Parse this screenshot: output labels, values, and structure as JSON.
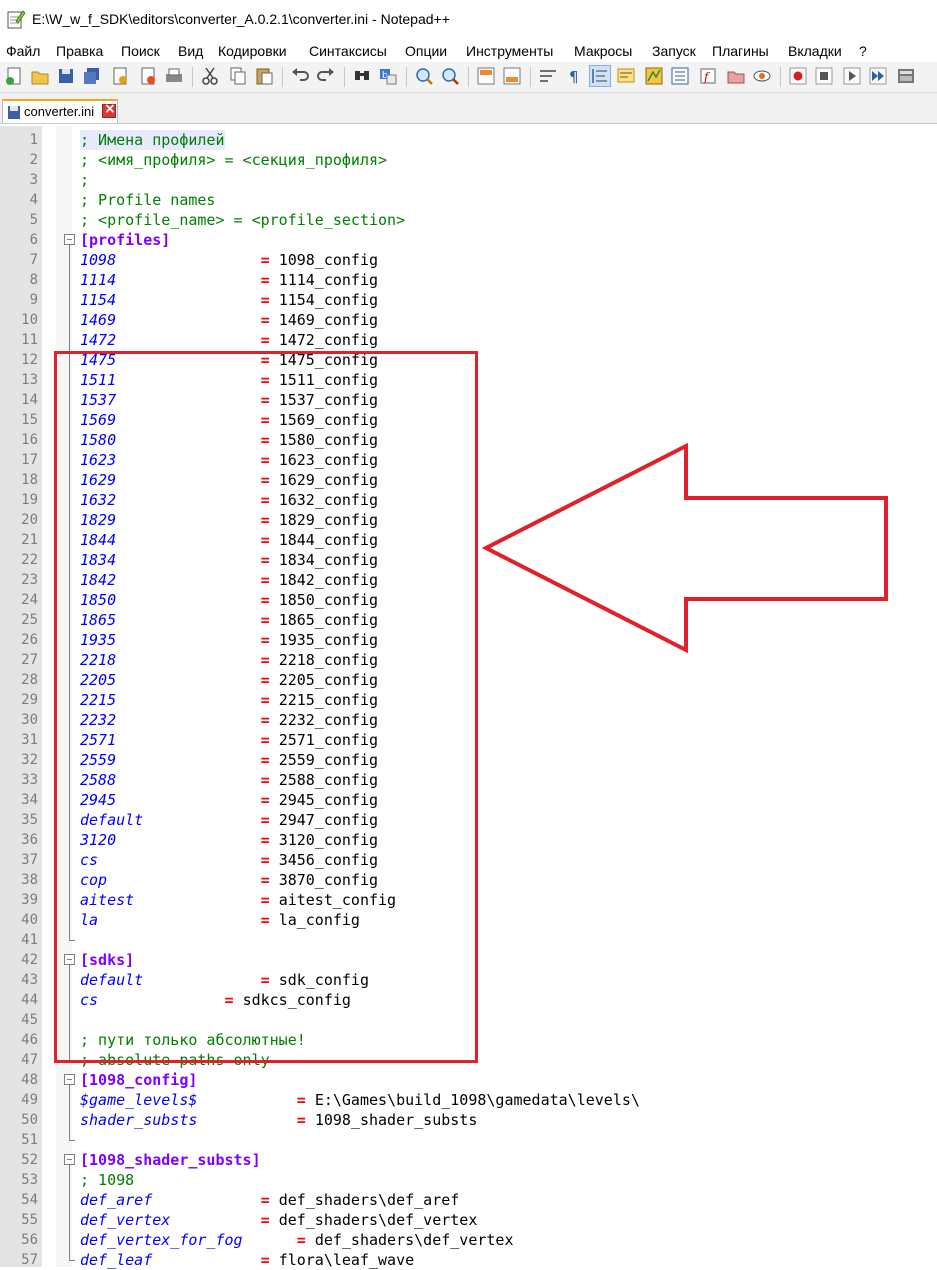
{
  "window": {
    "title": "E:\\W_w_f_SDK\\editors\\converter_A.0.2.1\\converter.ini - Notepad++"
  },
  "menu": [
    "Файл",
    "Правка",
    "Поиск",
    "Вид",
    "Кодировки",
    "Синтаксисы",
    "Опции",
    "Инструменты",
    "Макросы",
    "Запуск",
    "Плагины",
    "Вкладки",
    "?"
  ],
  "toolbar_icons": [
    "new-file-icon",
    "open-file-icon",
    "save-icon",
    "save-all-icon",
    "close-icon",
    "close-all-icon",
    "print-icon",
    "cut-icon",
    "copy-icon",
    "paste-icon",
    "undo-icon",
    "redo-icon",
    "find-icon",
    "replace-icon",
    "zoom-in-icon",
    "zoom-out-icon",
    "sync-vertical-icon",
    "sync-horizontal-icon",
    "word-wrap-icon",
    "show-all-chars-icon",
    "indent-guide-icon",
    "language-icon",
    "doc-map-icon",
    "function-list-icon",
    "folder-as-workspace-icon",
    "monitoring-icon",
    "record-macro-icon",
    "stop-macro-icon",
    "play-macro-icon",
    "run-macro-multiple-icon",
    "save-macro-icon"
  ],
  "tab": {
    "label": "converter.ini"
  },
  "colors": {
    "comment": "#008000",
    "section": "#8000ff",
    "key": "#0000ff",
    "equals": "#ff0000",
    "highlight_box": "#e0202a"
  },
  "lines": [
    {
      "n": "1",
      "parts": [
        {
          "t": "; Имена профилей",
          "c": "comment"
        }
      ]
    },
    {
      "n": "2",
      "parts": [
        {
          "t": "; <имя_профиля> = <секция_профиля>",
          "c": "comment"
        }
      ]
    },
    {
      "n": "3",
      "parts": [
        {
          "t": ";",
          "c": "comment"
        }
      ]
    },
    {
      "n": "4",
      "parts": [
        {
          "t": "; Profile names",
          "c": "comment"
        }
      ]
    },
    {
      "n": "5",
      "parts": [
        {
          "t": "; <profile_name> = <profile_section>",
          "c": "comment"
        }
      ]
    },
    {
      "n": "6",
      "parts": [
        {
          "t": "[profiles]",
          "c": "section"
        }
      ]
    },
    {
      "n": "7",
      "parts": [
        {
          "t": "1098",
          "c": "key"
        },
        {
          "t": "                = ",
          "c": "eq"
        },
        {
          "t": "1098_config",
          "c": "val"
        }
      ]
    },
    {
      "n": "8",
      "parts": [
        {
          "t": "1114",
          "c": "key"
        },
        {
          "t": "                = ",
          "c": "eq"
        },
        {
          "t": "1114_config",
          "c": "val"
        }
      ]
    },
    {
      "n": "9",
      "parts": [
        {
          "t": "1154",
          "c": "key"
        },
        {
          "t": "                = ",
          "c": "eq"
        },
        {
          "t": "1154_config",
          "c": "val"
        }
      ]
    },
    {
      "n": "10",
      "parts": [
        {
          "t": "1469",
          "c": "key"
        },
        {
          "t": "                = ",
          "c": "eq"
        },
        {
          "t": "1469_config",
          "c": "val"
        }
      ]
    },
    {
      "n": "11",
      "parts": [
        {
          "t": "1472",
          "c": "key"
        },
        {
          "t": "                = ",
          "c": "eq"
        },
        {
          "t": "1472_config",
          "c": "val"
        }
      ]
    },
    {
      "n": "12",
      "parts": [
        {
          "t": "1475",
          "c": "key"
        },
        {
          "t": "                = ",
          "c": "eq"
        },
        {
          "t": "1475_config",
          "c": "val"
        }
      ]
    },
    {
      "n": "13",
      "parts": [
        {
          "t": "1511",
          "c": "key"
        },
        {
          "t": "                = ",
          "c": "eq"
        },
        {
          "t": "1511_config",
          "c": "val"
        }
      ]
    },
    {
      "n": "14",
      "parts": [
        {
          "t": "1537",
          "c": "key"
        },
        {
          "t": "                = ",
          "c": "eq"
        },
        {
          "t": "1537_config",
          "c": "val"
        }
      ]
    },
    {
      "n": "15",
      "parts": [
        {
          "t": "1569",
          "c": "key"
        },
        {
          "t": "                = ",
          "c": "eq"
        },
        {
          "t": "1569_config",
          "c": "val"
        }
      ]
    },
    {
      "n": "16",
      "parts": [
        {
          "t": "1580",
          "c": "key"
        },
        {
          "t": "                = ",
          "c": "eq"
        },
        {
          "t": "1580_config",
          "c": "val"
        }
      ]
    },
    {
      "n": "17",
      "parts": [
        {
          "t": "1623",
          "c": "key"
        },
        {
          "t": "                = ",
          "c": "eq"
        },
        {
          "t": "1623_config",
          "c": "val"
        }
      ]
    },
    {
      "n": "18",
      "parts": [
        {
          "t": "1629",
          "c": "key"
        },
        {
          "t": "                = ",
          "c": "eq"
        },
        {
          "t": "1629_config",
          "c": "val"
        }
      ]
    },
    {
      "n": "19",
      "parts": [
        {
          "t": "1632",
          "c": "key"
        },
        {
          "t": "                = ",
          "c": "eq"
        },
        {
          "t": "1632_config",
          "c": "val"
        }
      ]
    },
    {
      "n": "20",
      "parts": [
        {
          "t": "1829",
          "c": "key"
        },
        {
          "t": "                = ",
          "c": "eq"
        },
        {
          "t": "1829_config",
          "c": "val"
        }
      ]
    },
    {
      "n": "21",
      "parts": [
        {
          "t": "1844",
          "c": "key"
        },
        {
          "t": "                = ",
          "c": "eq"
        },
        {
          "t": "1844_config",
          "c": "val"
        }
      ]
    },
    {
      "n": "22",
      "parts": [
        {
          "t": "1834",
          "c": "key"
        },
        {
          "t": "                = ",
          "c": "eq"
        },
        {
          "t": "1834_config",
          "c": "val"
        }
      ]
    },
    {
      "n": "23",
      "parts": [
        {
          "t": "1842",
          "c": "key"
        },
        {
          "t": "                = ",
          "c": "eq"
        },
        {
          "t": "1842_config",
          "c": "val"
        }
      ]
    },
    {
      "n": "24",
      "parts": [
        {
          "t": "1850",
          "c": "key"
        },
        {
          "t": "                = ",
          "c": "eq"
        },
        {
          "t": "1850_config",
          "c": "val"
        }
      ]
    },
    {
      "n": "25",
      "parts": [
        {
          "t": "1865",
          "c": "key"
        },
        {
          "t": "                = ",
          "c": "eq"
        },
        {
          "t": "1865_config",
          "c": "val"
        }
      ]
    },
    {
      "n": "26",
      "parts": [
        {
          "t": "1935",
          "c": "key"
        },
        {
          "t": "                = ",
          "c": "eq"
        },
        {
          "t": "1935_config",
          "c": "val"
        }
      ]
    },
    {
      "n": "27",
      "parts": [
        {
          "t": "2218",
          "c": "key"
        },
        {
          "t": "                = ",
          "c": "eq"
        },
        {
          "t": "2218_config",
          "c": "val"
        }
      ]
    },
    {
      "n": "28",
      "parts": [
        {
          "t": "2205",
          "c": "key"
        },
        {
          "t": "                = ",
          "c": "eq"
        },
        {
          "t": "2205_config",
          "c": "val"
        }
      ]
    },
    {
      "n": "29",
      "parts": [
        {
          "t": "2215",
          "c": "key"
        },
        {
          "t": "                = ",
          "c": "eq"
        },
        {
          "t": "2215_config",
          "c": "val"
        }
      ]
    },
    {
      "n": "30",
      "parts": [
        {
          "t": "2232",
          "c": "key"
        },
        {
          "t": "                = ",
          "c": "eq"
        },
        {
          "t": "2232_config",
          "c": "val"
        }
      ]
    },
    {
      "n": "31",
      "parts": [
        {
          "t": "2571",
          "c": "key"
        },
        {
          "t": "                = ",
          "c": "eq"
        },
        {
          "t": "2571_config",
          "c": "val"
        }
      ]
    },
    {
      "n": "32",
      "parts": [
        {
          "t": "2559",
          "c": "key"
        },
        {
          "t": "                = ",
          "c": "eq"
        },
        {
          "t": "2559_config",
          "c": "val"
        }
      ]
    },
    {
      "n": "33",
      "parts": [
        {
          "t": "2588",
          "c": "key"
        },
        {
          "t": "                = ",
          "c": "eq"
        },
        {
          "t": "2588_config",
          "c": "val"
        }
      ]
    },
    {
      "n": "34",
      "parts": [
        {
          "t": "2945",
          "c": "key"
        },
        {
          "t": "                = ",
          "c": "eq"
        },
        {
          "t": "2945_config",
          "c": "val"
        }
      ]
    },
    {
      "n": "35",
      "parts": [
        {
          "t": "default",
          "c": "key"
        },
        {
          "t": "             = ",
          "c": "eq"
        },
        {
          "t": "2947_config",
          "c": "val"
        }
      ]
    },
    {
      "n": "36",
      "parts": [
        {
          "t": "3120",
          "c": "key"
        },
        {
          "t": "                = ",
          "c": "eq"
        },
        {
          "t": "3120_config",
          "c": "val"
        }
      ]
    },
    {
      "n": "37",
      "parts": [
        {
          "t": "cs",
          "c": "key"
        },
        {
          "t": "                  = ",
          "c": "eq"
        },
        {
          "t": "3456_config",
          "c": "val"
        }
      ]
    },
    {
      "n": "38",
      "parts": [
        {
          "t": "cop",
          "c": "key"
        },
        {
          "t": "                 = ",
          "c": "eq"
        },
        {
          "t": "3870_config",
          "c": "val"
        }
      ]
    },
    {
      "n": "39",
      "parts": [
        {
          "t": "aitest",
          "c": "key"
        },
        {
          "t": "              = ",
          "c": "eq"
        },
        {
          "t": "aitest_config",
          "c": "val"
        }
      ]
    },
    {
      "n": "40",
      "parts": [
        {
          "t": "la",
          "c": "key"
        },
        {
          "t": "                  = ",
          "c": "eq"
        },
        {
          "t": "la_config",
          "c": "val"
        }
      ]
    },
    {
      "n": "41",
      "parts": []
    },
    {
      "n": "42",
      "parts": [
        {
          "t": "[sdks]",
          "c": "section"
        }
      ]
    },
    {
      "n": "43",
      "parts": [
        {
          "t": "default",
          "c": "key"
        },
        {
          "t": "             = ",
          "c": "eq"
        },
        {
          "t": "sdk_config",
          "c": "val"
        }
      ]
    },
    {
      "n": "44",
      "parts": [
        {
          "t": "cs",
          "c": "key"
        },
        {
          "t": "              = ",
          "c": "eq"
        },
        {
          "t": "sdkcs_config",
          "c": "val"
        }
      ]
    },
    {
      "n": "45",
      "parts": []
    },
    {
      "n": "46",
      "parts": [
        {
          "t": "; пути только абсолютные!",
          "c": "comment"
        }
      ]
    },
    {
      "n": "47",
      "parts": [
        {
          "t": "; absolute paths only",
          "c": "comment"
        }
      ]
    },
    {
      "n": "48",
      "parts": [
        {
          "t": "[1098_config]",
          "c": "section"
        }
      ]
    },
    {
      "n": "49",
      "parts": [
        {
          "t": "$game_levels$",
          "c": "key"
        },
        {
          "t": "           = ",
          "c": "eq"
        },
        {
          "t": "E:\\Games\\build_1098\\gamedata\\levels\\",
          "c": "val"
        }
      ]
    },
    {
      "n": "50",
      "parts": [
        {
          "t": "shader_substs",
          "c": "key"
        },
        {
          "t": "           = ",
          "c": "eq"
        },
        {
          "t": "1098_shader_substs",
          "c": "val"
        }
      ]
    },
    {
      "n": "51",
      "parts": []
    },
    {
      "n": "52",
      "parts": [
        {
          "t": "[1098_shader_substs]",
          "c": "section"
        }
      ]
    },
    {
      "n": "53",
      "parts": [
        {
          "t": "; 1098",
          "c": "comment"
        }
      ]
    },
    {
      "n": "54",
      "parts": [
        {
          "t": "def_aref",
          "c": "key"
        },
        {
          "t": "            = ",
          "c": "eq"
        },
        {
          "t": "def_shaders\\def_aref",
          "c": "val"
        }
      ]
    },
    {
      "n": "55",
      "parts": [
        {
          "t": "def_vertex",
          "c": "key"
        },
        {
          "t": "          = ",
          "c": "eq"
        },
        {
          "t": "def_shaders\\def_vertex",
          "c": "val"
        }
      ]
    },
    {
      "n": "56",
      "parts": [
        {
          "t": "def_vertex_for_fog",
          "c": "key"
        },
        {
          "t": "      = ",
          "c": "eq"
        },
        {
          "t": "def_shaders\\def_vertex",
          "c": "val"
        }
      ]
    },
    {
      "n": "57",
      "parts": [
        {
          "t": "def_leaf",
          "c": "key"
        },
        {
          "t": "            = ",
          "c": "eq"
        },
        {
          "t": "flora\\leaf_wave",
          "c": "val"
        }
      ]
    }
  ]
}
